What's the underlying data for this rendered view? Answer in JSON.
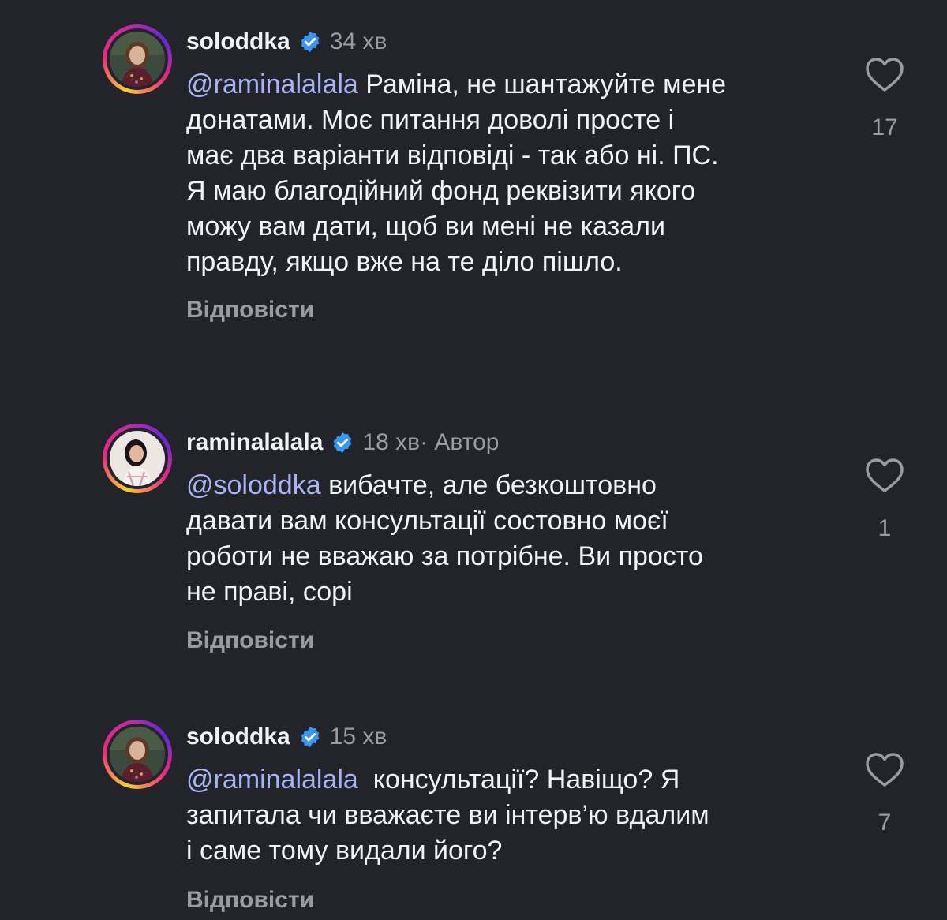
{
  "comments": [
    {
      "username": "soloddka",
      "verified": true,
      "time": "34 хв",
      "meta_suffix": "",
      "mention": "@raminalalala",
      "lines": [
        " Раміна, не шантажуйте мене",
        "донатами. Моє питання доволі просте і",
        "має два варіанти відповіді - так або ні. ПС.",
        "Я маю благодійний фонд реквізити якого",
        "можу вам дати, щоб ви мені не казали",
        "правду, якщо вже на те діло пішло."
      ],
      "reply_label": "Відповісти",
      "like_count": "17",
      "avatar_icon": "woman-dark-hair-portrait"
    },
    {
      "username": "raminalalala",
      "verified": true,
      "time": "18 хв",
      "meta_suffix": " · Автор",
      "mention": "@soloddka",
      "lines": [
        " вибачте, але безкоштовно",
        "давати вам консультації состовно моєї",
        "роботи не вважаю за потрібне. Ви просто",
        "не праві, сорі"
      ],
      "reply_label": "Відповісти",
      "like_count": "1",
      "avatar_icon": "woman-light-background-portrait"
    },
    {
      "username": "soloddka",
      "verified": true,
      "time": "15 хв",
      "meta_suffix": "",
      "mention": "@raminalalala",
      "lines": [
        "  консультації? Навіщо? Я",
        "запитала чи вважаєте ви інтерв’ю вдалим",
        "і саме тому видали його?"
      ],
      "reply_label": "Відповісти",
      "like_count": "7",
      "avatar_icon": "woman-dark-hair-portrait"
    }
  ],
  "colors": {
    "background": "#22242a",
    "text": "#f2f3f5",
    "secondary": "#9a9ca3",
    "mention": "#a9b4f5",
    "verified": "#3897f0"
  }
}
